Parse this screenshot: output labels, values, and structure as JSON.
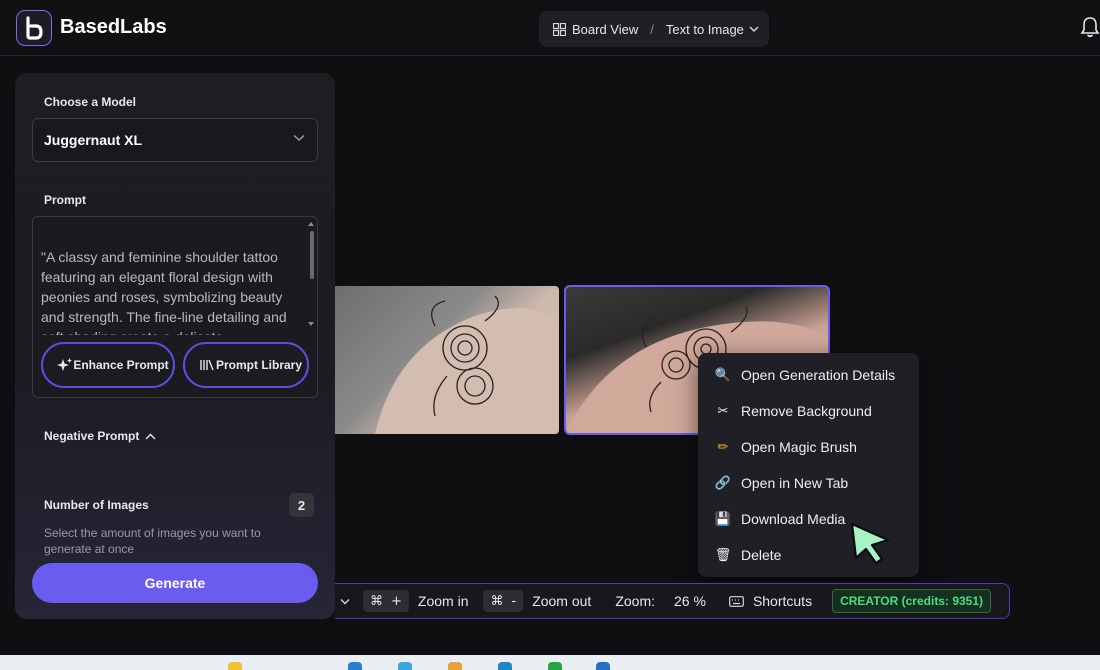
{
  "app": {
    "title": "BasedLabs"
  },
  "header": {
    "board_view": "Board View",
    "separator": "/",
    "mode": "Text to Image"
  },
  "sidebar": {
    "model_label": "Choose a Model",
    "model_value": "Juggernaut XL",
    "prompt_label": "Prompt",
    "prompt_text": "\"A classy and feminine shoulder tattoo featuring an elegant floral design with peonies and roses, symbolizing beauty and strength. The fine-line detailing and soft shading create a delicate",
    "enhance_button": "Enhance Prompt",
    "library_button": "Prompt Library",
    "negative_label": "Negative Prompt",
    "num_images_label": "Number of Images",
    "num_images_value": "2",
    "num_images_help": "Select the amount of images you want to generate at once",
    "generate_button": "Generate"
  },
  "context_menu": {
    "items": [
      {
        "label": "Open Generation Details",
        "icon": "magnifier-icon"
      },
      {
        "label": "Remove Background",
        "icon": "scissors-icon"
      },
      {
        "label": "Open Magic Brush",
        "icon": "pencil-icon"
      },
      {
        "label": "Open in New Tab",
        "icon": "link-icon"
      },
      {
        "label": "Download Media",
        "icon": "floppy-disk-icon"
      },
      {
        "label": "Delete",
        "icon": "trash-icon"
      }
    ]
  },
  "toolbar": {
    "cmd_symbol": "⌘",
    "zoom_in_key": "+",
    "zoom_in_label": "Zoom in",
    "zoom_out_key": "-",
    "zoom_out_label": "Zoom out",
    "zoom_label": "Zoom:",
    "zoom_value": "26 %",
    "shortcuts_label": "Shortcuts",
    "credits_badge": "CREATOR (credits: 9351)"
  },
  "colors": {
    "accent": "#6b5cf0",
    "credits_green": "#4ade80",
    "background": "#0f0f12"
  }
}
